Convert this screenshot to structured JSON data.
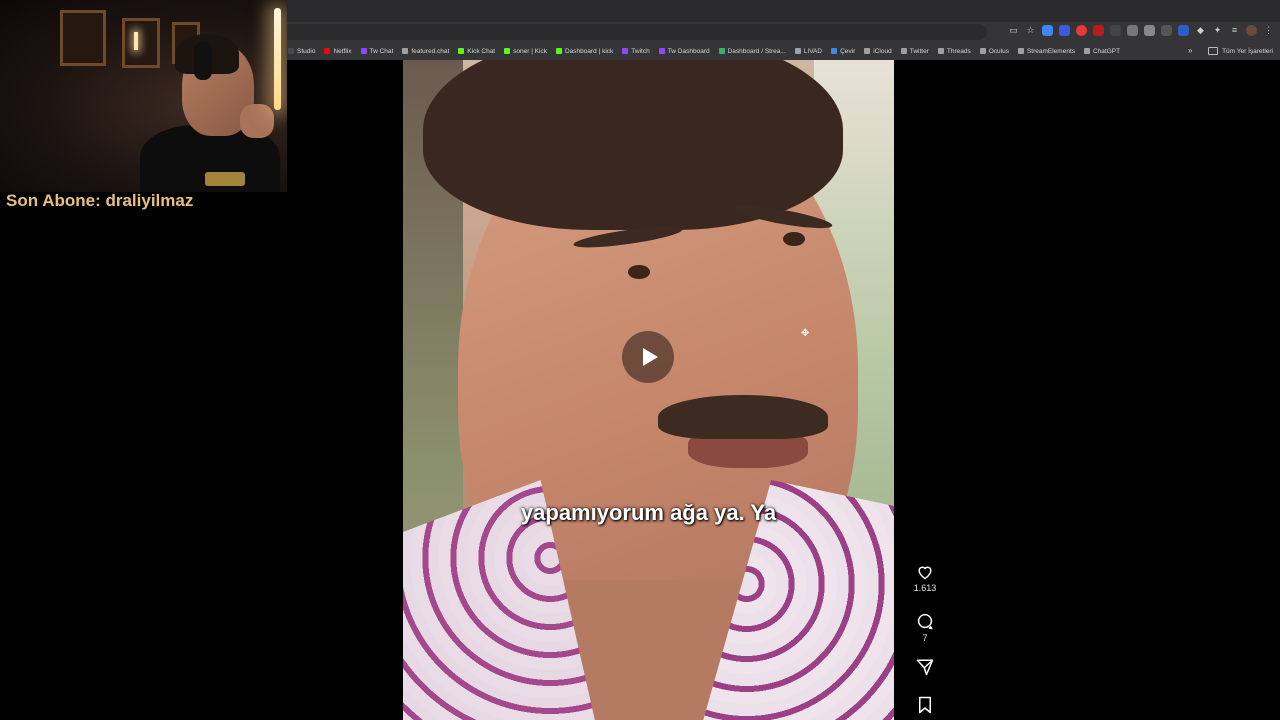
{
  "browser": {
    "bookmarks": [
      {
        "label": "Studio",
        "color": "#4a4a4a"
      },
      {
        "label": "Netflix",
        "color": "#e50914"
      },
      {
        "label": "Tw Chat",
        "color": "#9146ff"
      },
      {
        "label": "featured.chat",
        "color": "#9aa0a6"
      },
      {
        "label": "Kick Chat",
        "color": "#53fc18"
      },
      {
        "label": "soner | Kick",
        "color": "#53fc18"
      },
      {
        "label": "Dashboard | kick",
        "color": "#53fc18"
      },
      {
        "label": "Twitch",
        "color": "#9146ff"
      },
      {
        "label": "Tw Dashboard",
        "color": "#9146ff"
      },
      {
        "label": "Dashboard / Strea...",
        "color": "#2fb36b"
      },
      {
        "label": "LIVAD",
        "color": "#9aa0a6"
      },
      {
        "label": "Çevir",
        "color": "#4285f4"
      },
      {
        "label": "iCloud",
        "color": "#9aa0a6"
      },
      {
        "label": "Twitter",
        "color": "#9aa0a6"
      },
      {
        "label": "Threads",
        "color": "#9aa0a6"
      },
      {
        "label": "Oculus",
        "color": "#9aa0a6"
      },
      {
        "label": "StreamElements",
        "color": "#9aa0a6"
      },
      {
        "label": "ChatGPT",
        "color": "#9aa0a6"
      }
    ],
    "more_label": "»",
    "all_bookmarks_label": "Tüm Yer İşaretleri"
  },
  "overlay": {
    "last_subscriber": "Son Abone: draliyilmaz"
  },
  "reel": {
    "caption": "yapamıyorum ağa ya. Ya",
    "likes": "1.613",
    "comments": "7"
  }
}
